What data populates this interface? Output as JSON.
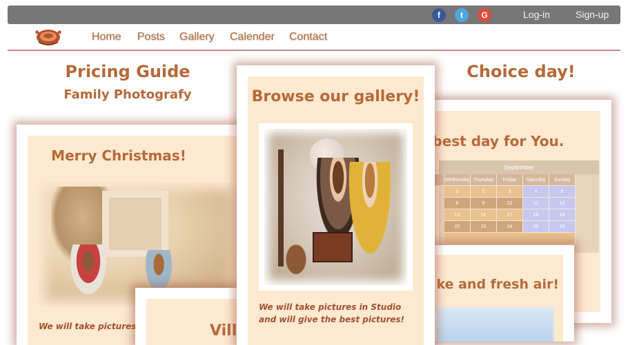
{
  "topbar": {
    "social": [
      {
        "icon": "facebook-icon",
        "glyph": "f",
        "color": "#3b5998"
      },
      {
        "icon": "twitter-icon",
        "glyph": "t",
        "color": "#4da7e0"
      },
      {
        "icon": "google-icon",
        "glyph": "G",
        "color": "#dd4b39"
      }
    ],
    "login_label": "Log-in",
    "signup_label": "Sign-up"
  },
  "nav": {
    "logo_icon": "camera-logo-icon",
    "items": [
      "Home",
      "Posts",
      "Gallery",
      "Calender",
      "Contact"
    ]
  },
  "pricing": {
    "title": "Pricing Guide",
    "subtitle": "Family Photografy"
  },
  "choice": {
    "title": "Choice day!",
    "card_title": "ce best day for You.",
    "calendar_month": "September",
    "calendar_days": [
      "",
      "Wednesday",
      "Thursday",
      "Friday",
      "Saturday",
      "Sunday"
    ],
    "calendar_rows": [
      [
        "",
        "1",
        "2",
        "3",
        "4",
        "5"
      ],
      [
        "",
        "8",
        "9",
        "10",
        "11",
        "12"
      ],
      [
        "",
        "15",
        "16",
        "17",
        "18",
        "19"
      ],
      [
        "",
        "22",
        "23",
        "24",
        "25",
        "26"
      ]
    ],
    "fresh_text": "ke and fresh air!"
  },
  "christmas": {
    "title": "Merry Christmas!",
    "text": "We will take pictures in"
  },
  "villa": {
    "text": "Villa"
  },
  "gallery": {
    "title": "Browse our gallery!",
    "text": "We will take pictures in Studio and will give the best pictures!"
  },
  "colors": {
    "accent": "#b56a38",
    "card_bg": "#fde8d0",
    "topbar": "#777777",
    "weekend": "#c7c8f0"
  }
}
